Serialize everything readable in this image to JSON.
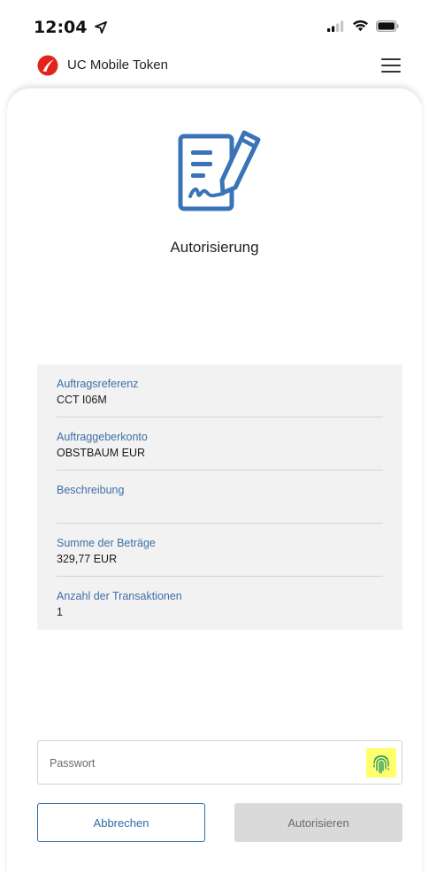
{
  "status_bar": {
    "time": "12:04"
  },
  "header": {
    "app_name": "UC Mobile Token",
    "logo_color": "#e2231a"
  },
  "page": {
    "title": "Autorisierung",
    "icon": "document-sign-icon",
    "icon_color": "#3a73b7"
  },
  "details": [
    {
      "label": "Auftragsreferenz",
      "value": "CCT I06M"
    },
    {
      "label": "Auftraggeberkonto",
      "value": "OBSTBAUM EUR"
    },
    {
      "label": "Beschreibung",
      "value": ""
    },
    {
      "label": "Summe der Beträge",
      "value": "329,77 EUR"
    },
    {
      "label": "Anzahl der Transaktionen",
      "value": "1"
    }
  ],
  "password": {
    "placeholder": "Passwort",
    "value": "",
    "fingerprint_icon": "fingerprint-icon",
    "fingerprint_highlight": "#ffff6b"
  },
  "buttons": {
    "cancel_label": "Abbrechen",
    "authorize_label": "Autorisieren"
  },
  "colors": {
    "label_blue": "#3f6fa8",
    "primary_blue": "#2d6ca8",
    "disabled_gray": "#dadada"
  }
}
